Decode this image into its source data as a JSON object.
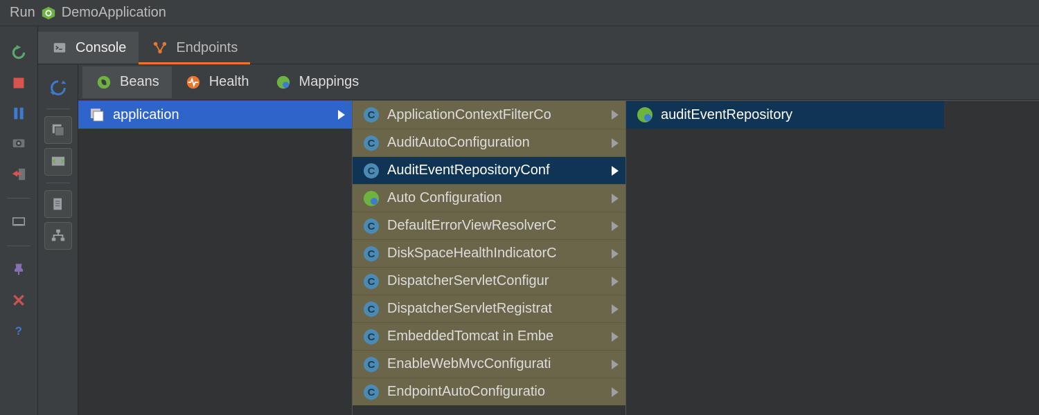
{
  "run": {
    "label": "Run",
    "title": "DemoApplication"
  },
  "tabs": {
    "console": "Console",
    "endpoints": "Endpoints"
  },
  "subtabs": {
    "beans": "Beans",
    "health": "Health",
    "mappings": "Mappings"
  },
  "columnA": {
    "items": [
      {
        "label": "application",
        "icon": "stack",
        "selected": true,
        "hasChildren": true
      }
    ]
  },
  "columnB": {
    "items": [
      {
        "label": "ApplicationContextFilterCo",
        "icon": "class",
        "hasChildren": true
      },
      {
        "label": "AuditAutoConfiguration",
        "icon": "class",
        "hasChildren": true
      },
      {
        "label": "AuditEventRepositoryConf",
        "icon": "class",
        "hasChildren": true,
        "selected": true
      },
      {
        "label": "Auto Configuration",
        "icon": "spring",
        "hasChildren": true
      },
      {
        "label": "DefaultErrorViewResolverC",
        "icon": "class",
        "hasChildren": true
      },
      {
        "label": "DiskSpaceHealthIndicatorC",
        "icon": "class",
        "hasChildren": true
      },
      {
        "label": "DispatcherServletConfigur",
        "icon": "class",
        "hasChildren": true
      },
      {
        "label": "DispatcherServletRegistrat",
        "icon": "class",
        "hasChildren": true
      },
      {
        "label": "EmbeddedTomcat in Embe",
        "icon": "class",
        "hasChildren": true
      },
      {
        "label": "EnableWebMvcConfigurati",
        "icon": "class",
        "hasChildren": true
      },
      {
        "label": "EndpointAutoConfiguratio",
        "icon": "class",
        "hasChildren": true
      }
    ]
  },
  "columnC": {
    "items": [
      {
        "label": "auditEventRepository",
        "icon": "spring",
        "selected": true
      }
    ]
  }
}
